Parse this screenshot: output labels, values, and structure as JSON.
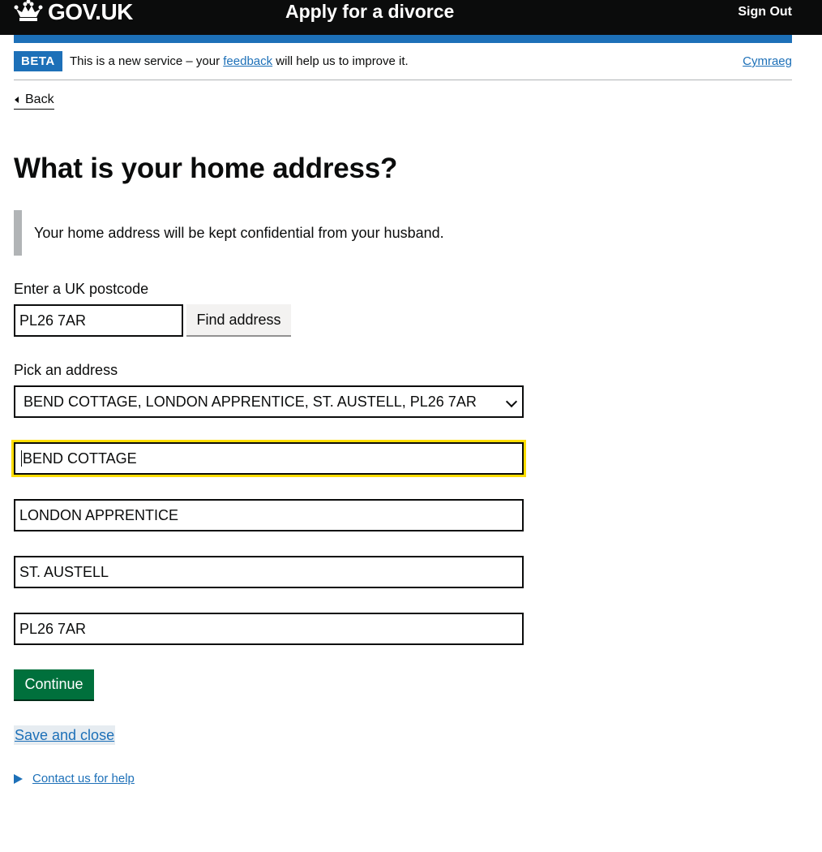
{
  "header": {
    "logo_text": "GOV.UK",
    "service_name": "Apply for a divorce",
    "sign_out_label": "Sign Out"
  },
  "phase_banner": {
    "tag": "BETA",
    "text_before": "This is a new service – your ",
    "feedback_link": "feedback",
    "text_after": " will help us to improve it.",
    "language_link": "Cymraeg"
  },
  "back_link": "Back",
  "page_title": "What is your home address?",
  "inset_text": "Your home address will be kept confidential from your husband.",
  "postcode": {
    "label": "Enter a UK postcode",
    "value": "PL26 7AR",
    "find_button": "Find address"
  },
  "address_picker": {
    "label": "Pick an address",
    "selected": "BEND COTTAGE, LONDON APPRENTICE, ST. AUSTELL, PL26 7AR"
  },
  "address_lines": [
    "BEND COTTAGE",
    "LONDON APPRENTICE",
    "ST. AUSTELL",
    "PL26 7AR"
  ],
  "continue_button": "Continue",
  "save_link": "Save and close",
  "help_link": "Contact us for help",
  "colors": {
    "header_bg": "#0b0c0c",
    "brand_blue": "#1d70b8",
    "focus_yellow": "#ffdd00",
    "button_green": "#00703c"
  }
}
